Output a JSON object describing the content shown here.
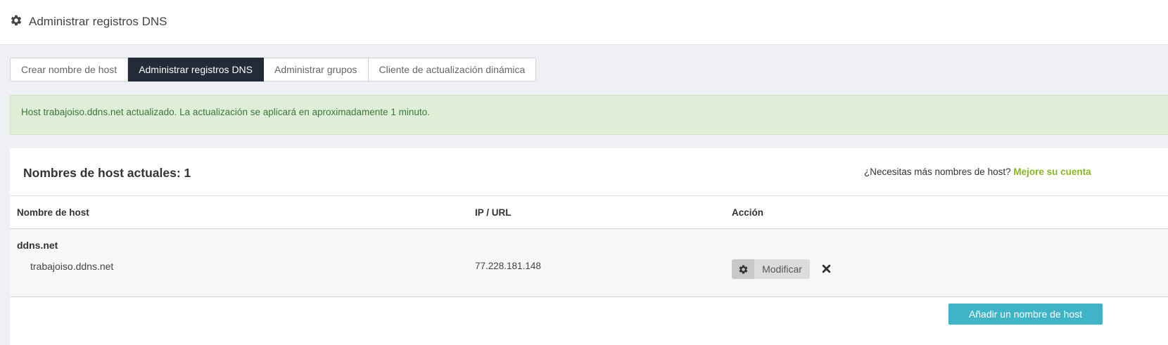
{
  "header": {
    "icon": "gear-icon",
    "title": "Administrar registros DNS"
  },
  "tabs": [
    {
      "label": "Crear nombre de host",
      "active": false
    },
    {
      "label": "Administrar registros DNS",
      "active": true
    },
    {
      "label": "Administrar grupos",
      "active": false
    },
    {
      "label": "Cliente de actualización dinámica",
      "active": false
    }
  ],
  "alert": {
    "message": "Host trabajoiso.ddns.net actualizado. La actualización se aplicará en aproximadamente 1 minuto."
  },
  "panel": {
    "title": "Nombres de host actuales: 1",
    "upgrade_prompt": "¿Necesitas más nombres de host?",
    "upgrade_link": "Mejore su cuenta"
  },
  "table": {
    "columns": [
      "Nombre de host",
      "IP / URL",
      "Acción"
    ],
    "groups": [
      {
        "domain": "ddns.net",
        "rows": [
          {
            "hostname": "trabajoiso.ddns.net",
            "ip": "77.228.181.148",
            "modify_label": "Modificar"
          }
        ]
      }
    ]
  },
  "add_button_label": "Añadir un nombre de host",
  "colors": {
    "active_tab": "#232b38",
    "alert_bg": "#dfeed6",
    "alert_text": "#3c763d",
    "upgrade_link": "#8ab529",
    "add_button": "#3fb4c6"
  }
}
